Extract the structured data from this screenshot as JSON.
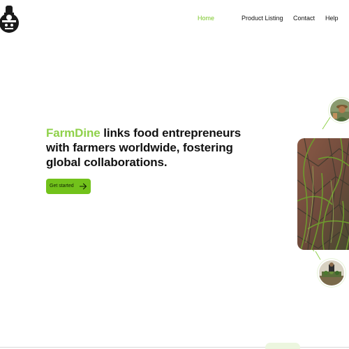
{
  "header": {
    "logo_icon": "farm-chef-logo",
    "nav": [
      {
        "label": "Home",
        "active": true
      },
      {
        "label": "Product Listing",
        "active": false
      },
      {
        "label": "Contact",
        "active": false
      },
      {
        "label": "Help",
        "active": false
      }
    ]
  },
  "hero": {
    "brand": "FarmDine",
    "headline": " links food entrepreneurs with farmers worldwide, fostering global collaborations.",
    "cta_label": "Get started",
    "cta_icon": "arrow-right-icon"
  },
  "colors": {
    "accent": "#7cc72a",
    "brand_text": "#8fd14a",
    "button": "#72c21b",
    "text": "#111111"
  }
}
